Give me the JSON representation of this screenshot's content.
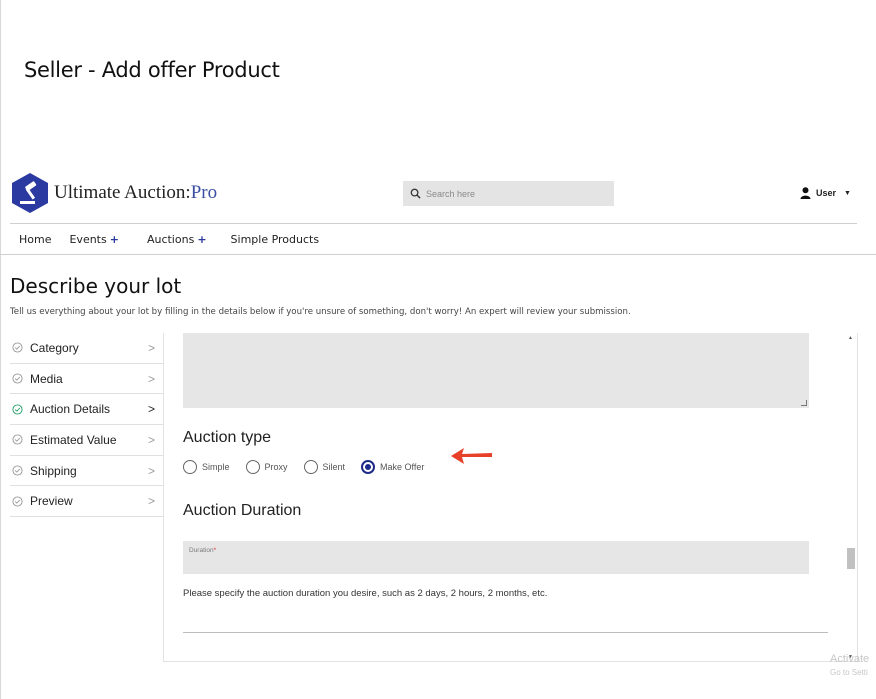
{
  "doc_title": "Seller - Add offer Product",
  "brand": {
    "name_main": "Ultimate Auction:",
    "name_accent": "Pro",
    "accent_color": "#3a4fa3",
    "logo_color": "#2b3aa0"
  },
  "search": {
    "placeholder": "Search here",
    "icon": "search-icon"
  },
  "user": {
    "label": "User",
    "icon": "user-icon",
    "caret": "▼"
  },
  "nav": {
    "home": "Home",
    "events": "Events",
    "auctions": "Auctions",
    "simple_products": "Simple Products",
    "plus": "+"
  },
  "lot": {
    "title": "Describe your lot",
    "subtitle": "Tell us everything about your lot by filling in the details below if you're unsure of something, don't worry! An expert will review your submission."
  },
  "steps": [
    {
      "label": "Category",
      "active": false
    },
    {
      "label": "Media",
      "active": false
    },
    {
      "label": "Auction Details",
      "active": true
    },
    {
      "label": "Estimated Value",
      "active": false
    },
    {
      "label": "Shipping",
      "active": false
    },
    {
      "label": "Preview",
      "active": false
    }
  ],
  "chevron": ">",
  "auction_type": {
    "label": "Auction type",
    "options": [
      "Simple",
      "Proxy",
      "Silent",
      "Make Offer"
    ],
    "selected": "Make Offer"
  },
  "auction_duration": {
    "label": "Auction Duration",
    "field_label": "Duration",
    "required_mark": "*",
    "hint": "Please specify the auction duration you desire, such as 2 days, 2 hours, 2 months, etc."
  },
  "scrollbar": {
    "up": "▲",
    "down": "▼"
  },
  "watermark": {
    "line1": "Activate",
    "line2": "Go to Setti"
  },
  "colors": {
    "radio_selected": "#1e2a8a",
    "arrow": "#e8412a",
    "active_step_icon": "#27a06a"
  }
}
